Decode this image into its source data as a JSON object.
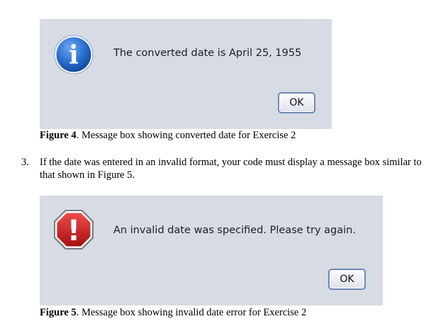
{
  "dialog_info": {
    "icon": "info-icon",
    "icon_glyph": "i",
    "message": "The converted date is April 25, 1955",
    "ok_label": "OK"
  },
  "figure4": {
    "label": "Figure 4",
    "text": ". Message box showing converted date for Exercise 2"
  },
  "step3": {
    "number": "3.",
    "text": "If the date was entered in an invalid format, your code must display a message box similar to that shown in Figure 5."
  },
  "dialog_error": {
    "icon": "error-stop-icon",
    "icon_glyph": "!",
    "message": "An invalid date was specified. Please try again.",
    "ok_label": "OK"
  },
  "figure5": {
    "label": "Figure 5",
    "text": ". Message box showing invalid date error for Exercise 2"
  },
  "colors": {
    "dialog_bg": "#d7dbe4",
    "info_blue": "#1e5fc2",
    "error_red": "#cc1a1a"
  }
}
